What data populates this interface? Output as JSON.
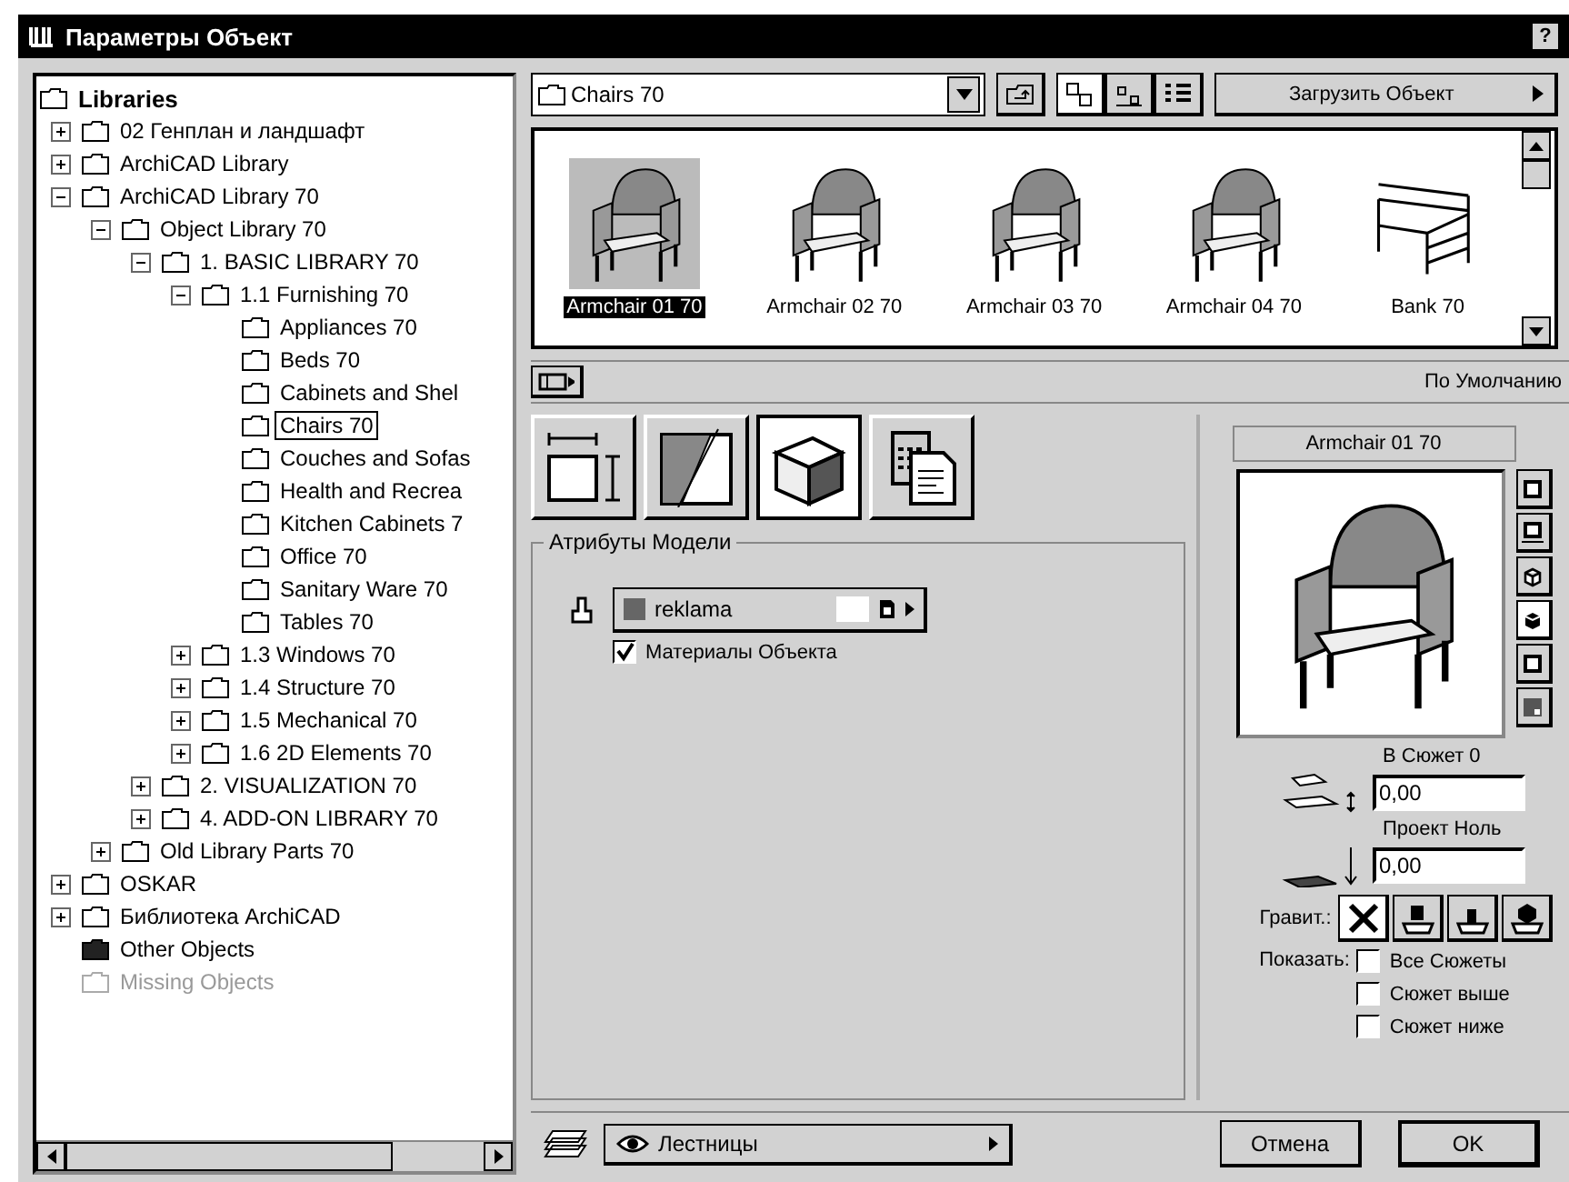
{
  "window": {
    "title": "Параметры Объект",
    "help": "?"
  },
  "tree": {
    "label": "Libraries",
    "kind": "folder",
    "selected": false,
    "disabled": false,
    "children": [
      {
        "label": "02 Генплан и ландшафт",
        "kind": "folder",
        "expanded": false,
        "selected": false,
        "disabled": false
      },
      {
        "label": "ArchiCAD Library",
        "kind": "folder",
        "expanded": false,
        "selected": false,
        "disabled": false
      },
      {
        "label": "ArchiCAD Library 70",
        "kind": "folder",
        "expanded": true,
        "selected": false,
        "disabled": false,
        "children": [
          {
            "label": "Object Library 70",
            "kind": "folder",
            "expanded": true,
            "selected": false,
            "disabled": false,
            "children": [
              {
                "label": "1. BASIC LIBRARY 70",
                "kind": "folder",
                "expanded": true,
                "selected": false,
                "disabled": false,
                "children": [
                  {
                    "label": "1.1 Furnishing 70",
                    "kind": "folder",
                    "expanded": true,
                    "selected": false,
                    "disabled": false,
                    "children": [
                      {
                        "label": "Appliances 70",
                        "kind": "folder",
                        "selected": false,
                        "disabled": false
                      },
                      {
                        "label": "Beds 70",
                        "kind": "folder",
                        "selected": false,
                        "disabled": false
                      },
                      {
                        "label": "Cabinets and Shel",
                        "kind": "folder",
                        "selected": false,
                        "disabled": false
                      },
                      {
                        "label": "Chairs 70",
                        "kind": "folder",
                        "selected": true,
                        "disabled": false
                      },
                      {
                        "label": "Couches and Sofas",
                        "kind": "folder",
                        "selected": false,
                        "disabled": false
                      },
                      {
                        "label": "Health and Recrea",
                        "kind": "folder",
                        "selected": false,
                        "disabled": false
                      },
                      {
                        "label": "Kitchen Cabinets 7",
                        "kind": "folder",
                        "selected": false,
                        "disabled": false
                      },
                      {
                        "label": "Office 70",
                        "kind": "folder",
                        "selected": false,
                        "disabled": false
                      },
                      {
                        "label": "Sanitary Ware 70",
                        "kind": "folder",
                        "selected": false,
                        "disabled": false
                      },
                      {
                        "label": "Tables 70",
                        "kind": "folder",
                        "selected": false,
                        "disabled": false
                      }
                    ]
                  },
                  {
                    "label": "1.3 Windows 70",
                    "kind": "folder",
                    "expanded": false,
                    "selected": false,
                    "disabled": false
                  },
                  {
                    "label": "1.4 Structure 70",
                    "kind": "folder",
                    "expanded": false,
                    "selected": false,
                    "disabled": false
                  },
                  {
                    "label": "1.5 Mechanical 70",
                    "kind": "folder",
                    "expanded": false,
                    "selected": false,
                    "disabled": false
                  },
                  {
                    "label": "1.6 2D Elements 70",
                    "kind": "folder",
                    "expanded": false,
                    "selected": false,
                    "disabled": false
                  }
                ]
              },
              {
                "label": "2. VISUALIZATION 70",
                "kind": "folder",
                "expanded": false,
                "selected": false,
                "disabled": false
              },
              {
                "label": "4. ADD-ON LIBRARY 70",
                "kind": "folder",
                "expanded": false,
                "selected": false,
                "disabled": false
              }
            ]
          },
          {
            "label": "Old Library Parts 70",
            "kind": "folder",
            "expanded": false,
            "selected": false,
            "disabled": false
          }
        ]
      },
      {
        "label": "OSKAR",
        "kind": "folder",
        "expanded": false,
        "selected": false,
        "disabled": false
      },
      {
        "label": "Библиотека ArchiCAD",
        "kind": "folder",
        "expanded": false,
        "selected": false,
        "disabled": false
      },
      {
        "label": "Other Objects",
        "kind": "dark-folder",
        "selected": false,
        "disabled": false
      },
      {
        "label": "Missing Objects",
        "kind": "folder",
        "selected": false,
        "disabled": true
      }
    ]
  },
  "location": {
    "value": "Chairs 70"
  },
  "view_modes": [
    {
      "kind": "large",
      "selected": true
    },
    {
      "kind": "small",
      "selected": false
    },
    {
      "kind": "list",
      "selected": false
    }
  ],
  "load_button": "Загрузить Объект",
  "objects": [
    {
      "label": "Armchair 01 70",
      "kind": "armchair",
      "selected": true
    },
    {
      "label": "Armchair 02 70",
      "kind": "armchair",
      "selected": false
    },
    {
      "label": "Armchair 03 70",
      "kind": "armchair",
      "selected": false
    },
    {
      "label": "Armchair 04 70",
      "kind": "armchair",
      "selected": false
    },
    {
      "label": "Bank 70",
      "kind": "bench",
      "selected": false
    }
  ],
  "preset": "По Умолчанию",
  "tabs": [
    {
      "kind": "dimensions",
      "selected": false
    },
    {
      "kind": "section",
      "selected": false
    },
    {
      "kind": "model",
      "selected": true
    },
    {
      "kind": "listing",
      "selected": false
    }
  ],
  "model_attributes": {
    "title": "Атрибуты Модели",
    "material": "reklama",
    "object_materials": {
      "label": "Материалы Объекта",
      "checked": true
    }
  },
  "preview": {
    "name": "Armchair 01 70",
    "views": [
      {
        "kind": "plan",
        "selected": false
      },
      {
        "kind": "section",
        "selected": false
      },
      {
        "kind": "wire",
        "selected": false
      },
      {
        "kind": "solid",
        "selected": true
      },
      {
        "kind": "film",
        "selected": false
      },
      {
        "kind": "page",
        "selected": false
      }
    ]
  },
  "elevation": {
    "story_label": "В Сюжет 0",
    "story_value": "0,00",
    "project_label": "Проект Ноль",
    "project_value": "0,00"
  },
  "gravity": {
    "label": "Гравит.:",
    "options": [
      {
        "kind": "none",
        "selected": true
      },
      {
        "kind": "top",
        "selected": false
      },
      {
        "kind": "middle",
        "selected": false
      },
      {
        "kind": "bottom",
        "selected": false
      }
    ]
  },
  "show": {
    "label": "Показать:",
    "options": [
      {
        "label": "Все Сюжеты",
        "checked": false
      },
      {
        "label": "Сюжет выше",
        "checked": false
      },
      {
        "label": "Сюжет ниже",
        "checked": false
      }
    ]
  },
  "layer": {
    "value": "Лестницы"
  },
  "buttons": {
    "cancel": "Отмена",
    "ok": "OK"
  }
}
